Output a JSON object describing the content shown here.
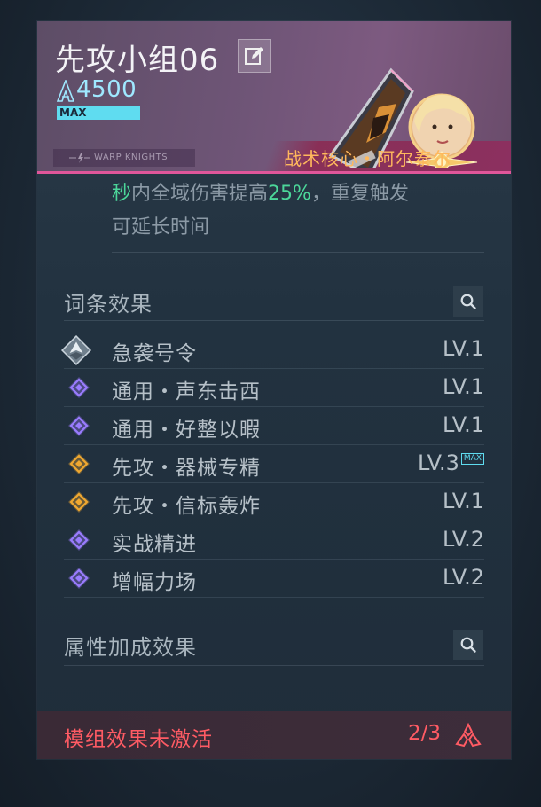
{
  "header": {
    "squad_name": "先攻小组06",
    "power_value": "4500",
    "max_label": "MAX",
    "brand": "WARP KNIGHTS",
    "core_label": "战术核心・阿尔泰尔",
    "colors": {
      "accent_pink": "#e0569a",
      "power_cyan": "#9fe8ff",
      "core_gold": "#ffb85c"
    }
  },
  "description": {
    "line1_prefix": "秒",
    "line1_mid": "内全域伤害提高",
    "line1_value": "25%",
    "line1_suffix": "，重复触发",
    "line2": "可延长时间"
  },
  "entries_section": {
    "title": "词条效果",
    "search_icon": "search-icon",
    "rows": [
      {
        "name": "急袭号令",
        "level": "LV.1",
        "icon": "silver-emblem-icon",
        "color": "#a9b6c2"
      },
      {
        "name": "通用・声东击西",
        "level": "LV.1",
        "icon": "purple-diamond-icon",
        "color": "#9a7cff"
      },
      {
        "name": "通用・好整以暇",
        "level": "LV.1",
        "icon": "purple-diamond-icon",
        "color": "#9a7cff"
      },
      {
        "name": "先攻・器械专精",
        "level": "LV.3",
        "max_tag": "MAX",
        "icon": "gold-diamond-icon",
        "color": "#f0a830"
      },
      {
        "name": "先攻・信标轰炸",
        "level": "LV.1",
        "icon": "gold-diamond-icon",
        "color": "#f0a830"
      },
      {
        "name": "实战精进",
        "level": "LV.2",
        "icon": "purple-diamond-icon",
        "color": "#9a7cff"
      },
      {
        "name": "增幅力场",
        "level": "LV.2",
        "icon": "purple-diamond-icon",
        "color": "#9a7cff"
      }
    ]
  },
  "attributes_section": {
    "title": "属性加成效果",
    "search_icon": "search-icon"
  },
  "footer": {
    "status": "模组效果未激活",
    "count": "2/3",
    "color": "#ff5b64"
  }
}
